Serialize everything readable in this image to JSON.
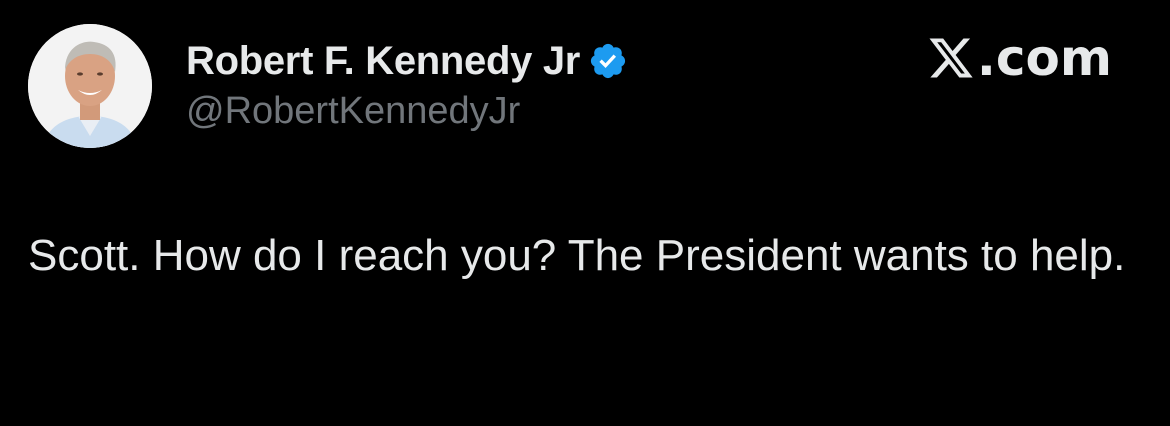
{
  "post": {
    "author": {
      "display_name": "Robert F. Kennedy Jr",
      "handle": "@RobertKennedyJr",
      "verified": true
    },
    "text": "Scott. How do I reach you? The President wants to help."
  },
  "brand": {
    "label": ".com",
    "icon": "x-logo-icon"
  },
  "colors": {
    "background": "#000000",
    "primary_text": "#e7e9ea",
    "secondary_text": "#71767b",
    "verified_badge": "#1d9bf0"
  }
}
